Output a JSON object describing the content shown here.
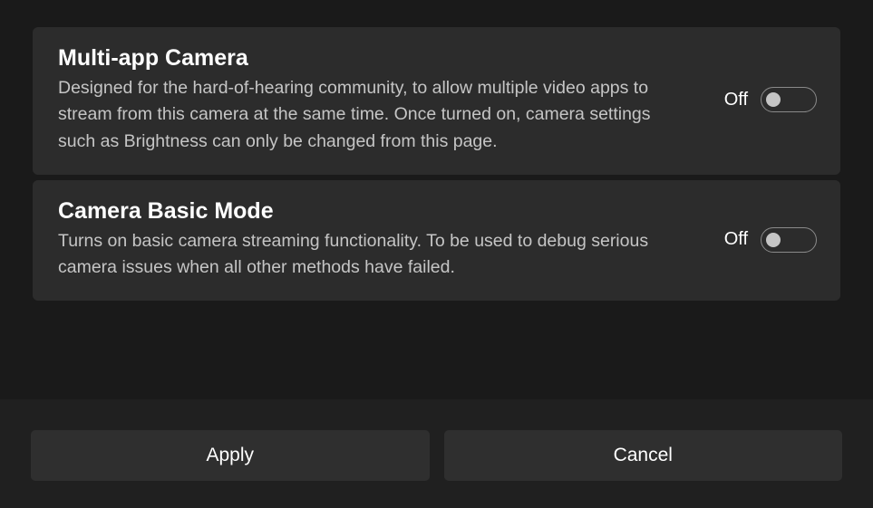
{
  "settings": [
    {
      "title": "Multi-app Camera",
      "description": "Designed for the hard-of-hearing community, to allow multiple video apps to stream from this camera at the same time. Once turned on, camera settings such as Brightness can only be changed from this page.",
      "state_label": "Off"
    },
    {
      "title": "Camera Basic Mode",
      "description": "Turns on basic camera streaming functionality. To be used to debug serious camera issues when all other methods have failed.",
      "state_label": "Off"
    }
  ],
  "footer": {
    "apply_label": "Apply",
    "cancel_label": "Cancel"
  }
}
